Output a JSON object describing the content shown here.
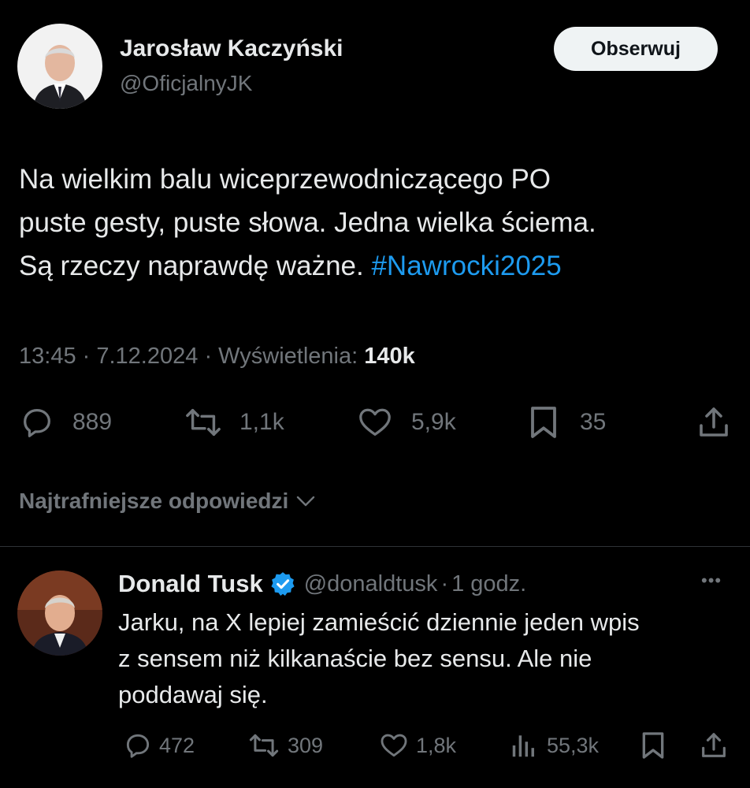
{
  "main_tweet": {
    "author_name": "Jarosław Kaczyński",
    "author_handle": "@OficjalnyJK",
    "follow_label": "Obserwuj",
    "text_lines": [
      "Na wielkim balu wiceprzewodniczącego PO",
      "puste gesty, puste słowa. Jedna wielka ściema.",
      "Są rzeczy naprawdę ważne."
    ],
    "hashtag": "#Nawrocki2025",
    "time": "13:45",
    "date": "7.12.2024",
    "views_label": "Wyświetlenia:",
    "views_count": "140k",
    "stats": {
      "replies": "889",
      "reposts": "1,1k",
      "likes": "5,9k",
      "bookmarks": "35"
    },
    "icons": [
      "reply-icon",
      "repost-icon",
      "like-icon",
      "bookmark-icon",
      "share-icon"
    ]
  },
  "replies_sort": {
    "label": "Najtrafniejsze odpowiedzi"
  },
  "reply": {
    "author_name": "Donald Tusk",
    "author_handle": "@donaldtusk",
    "time_ago": "1 godz.",
    "more_label": "•••",
    "text_lines": [
      "Jarku, na X lepiej zamieścić dziennie jeden wpis",
      "z sensem niż kilkanaście bez sensu. Ale nie",
      "poddawaj się."
    ],
    "stats": {
      "replies": "472",
      "reposts": "309",
      "likes": "1,8k",
      "views": "55,3k"
    }
  },
  "colors": {
    "background": "#000000",
    "text": "#e7e9ea",
    "muted": "#71767b",
    "link": "#1d9bf0",
    "verified": "#1d9bf0"
  }
}
